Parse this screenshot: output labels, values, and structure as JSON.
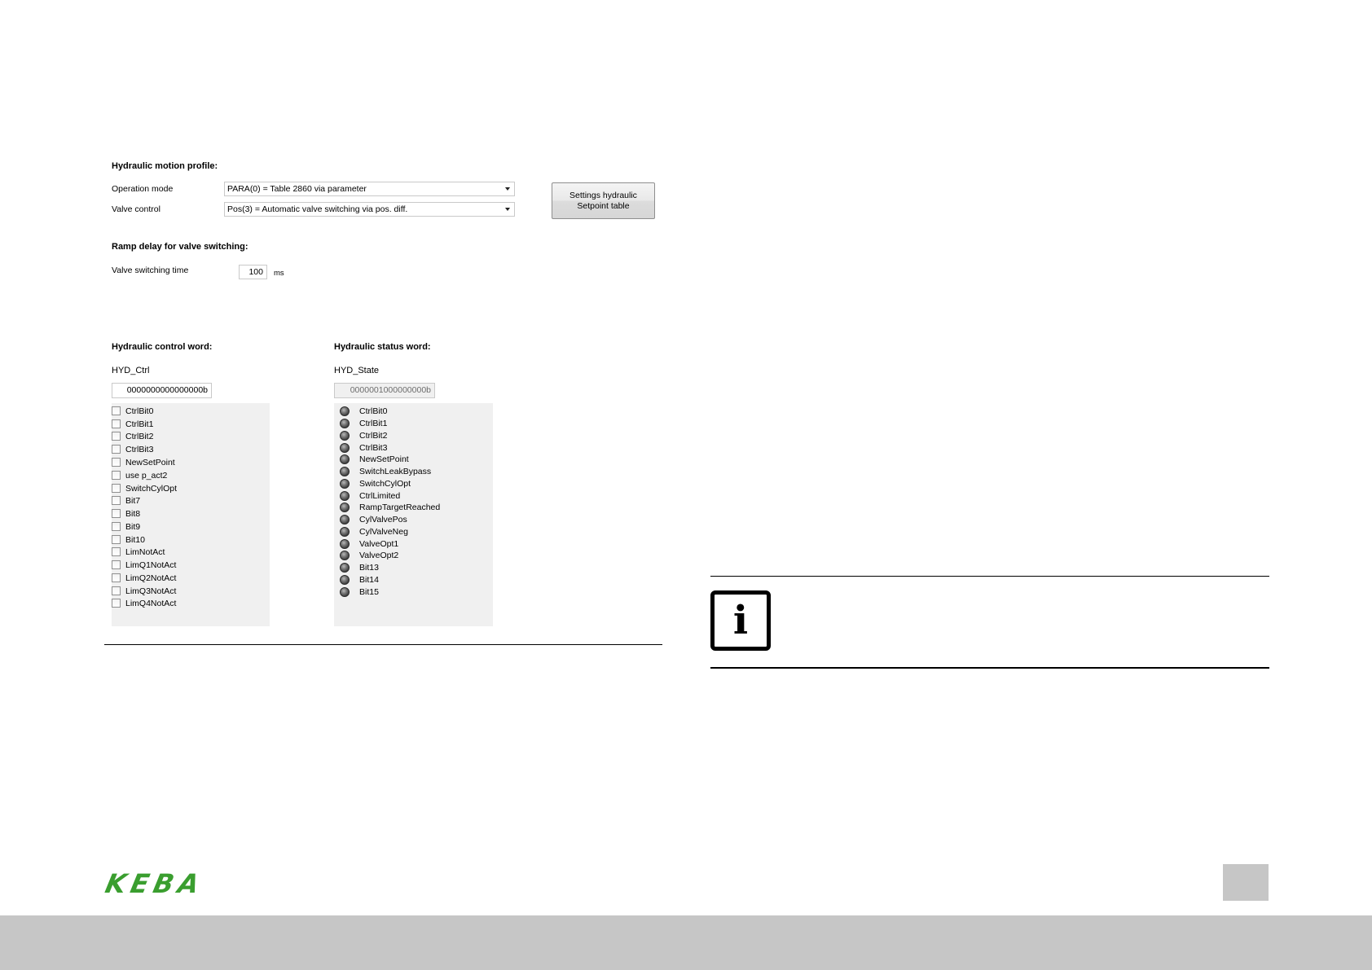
{
  "motion_profile": {
    "title": "Hydraulic motion profile:",
    "operation_mode_label": "Operation mode",
    "operation_mode_value": "PARA(0) = Table 2860 via parameter",
    "valve_control_label": "Valve control",
    "valve_control_value": "Pos(3) = Automatic valve switching via pos. diff.",
    "settings_button_line1": "Settings hydraulic",
    "settings_button_line2": "Setpoint table"
  },
  "ramp_delay": {
    "title": "Ramp delay for valve switching:",
    "valve_switching_label": "Valve switching time",
    "valve_switching_value": "100",
    "unit": "ms"
  },
  "control_word": {
    "title": "Hydraulic control word:",
    "name": "HYD_Ctrl",
    "value": "0000000000000000b",
    "bits": [
      "CtrlBit0",
      "CtrlBit1",
      "CtrlBit2",
      "CtrlBit3",
      "NewSetPoint",
      "use p_act2",
      "SwitchCylOpt",
      "Bit7",
      "Bit8",
      "Bit9",
      "Bit10",
      "LimNotAct",
      "LimQ1NotAct",
      "LimQ2NotAct",
      "LimQ3NotAct",
      "LimQ4NotAct"
    ]
  },
  "status_word": {
    "title": "Hydraulic status word:",
    "name": "HYD_State",
    "value": "0000001000000000b",
    "bits": [
      "CtrlBit0",
      "CtrlBit1",
      "CtrlBit2",
      "CtrlBit3",
      "NewSetPoint",
      "SwitchLeakBypass",
      "SwitchCylOpt",
      "CtrlLimited",
      "RampTargetReached",
      "CylValvePos",
      "CylValveNeg",
      "ValveOpt1",
      "ValveOpt2",
      "Bit13",
      "Bit14",
      "Bit15"
    ]
  },
  "footer": {
    "logo_text": "KEBA"
  },
  "colors": {
    "logo_green": "#3a9e2f",
    "footer_gray": "#c6c6c6",
    "panel_gray": "#f0f0f0"
  }
}
